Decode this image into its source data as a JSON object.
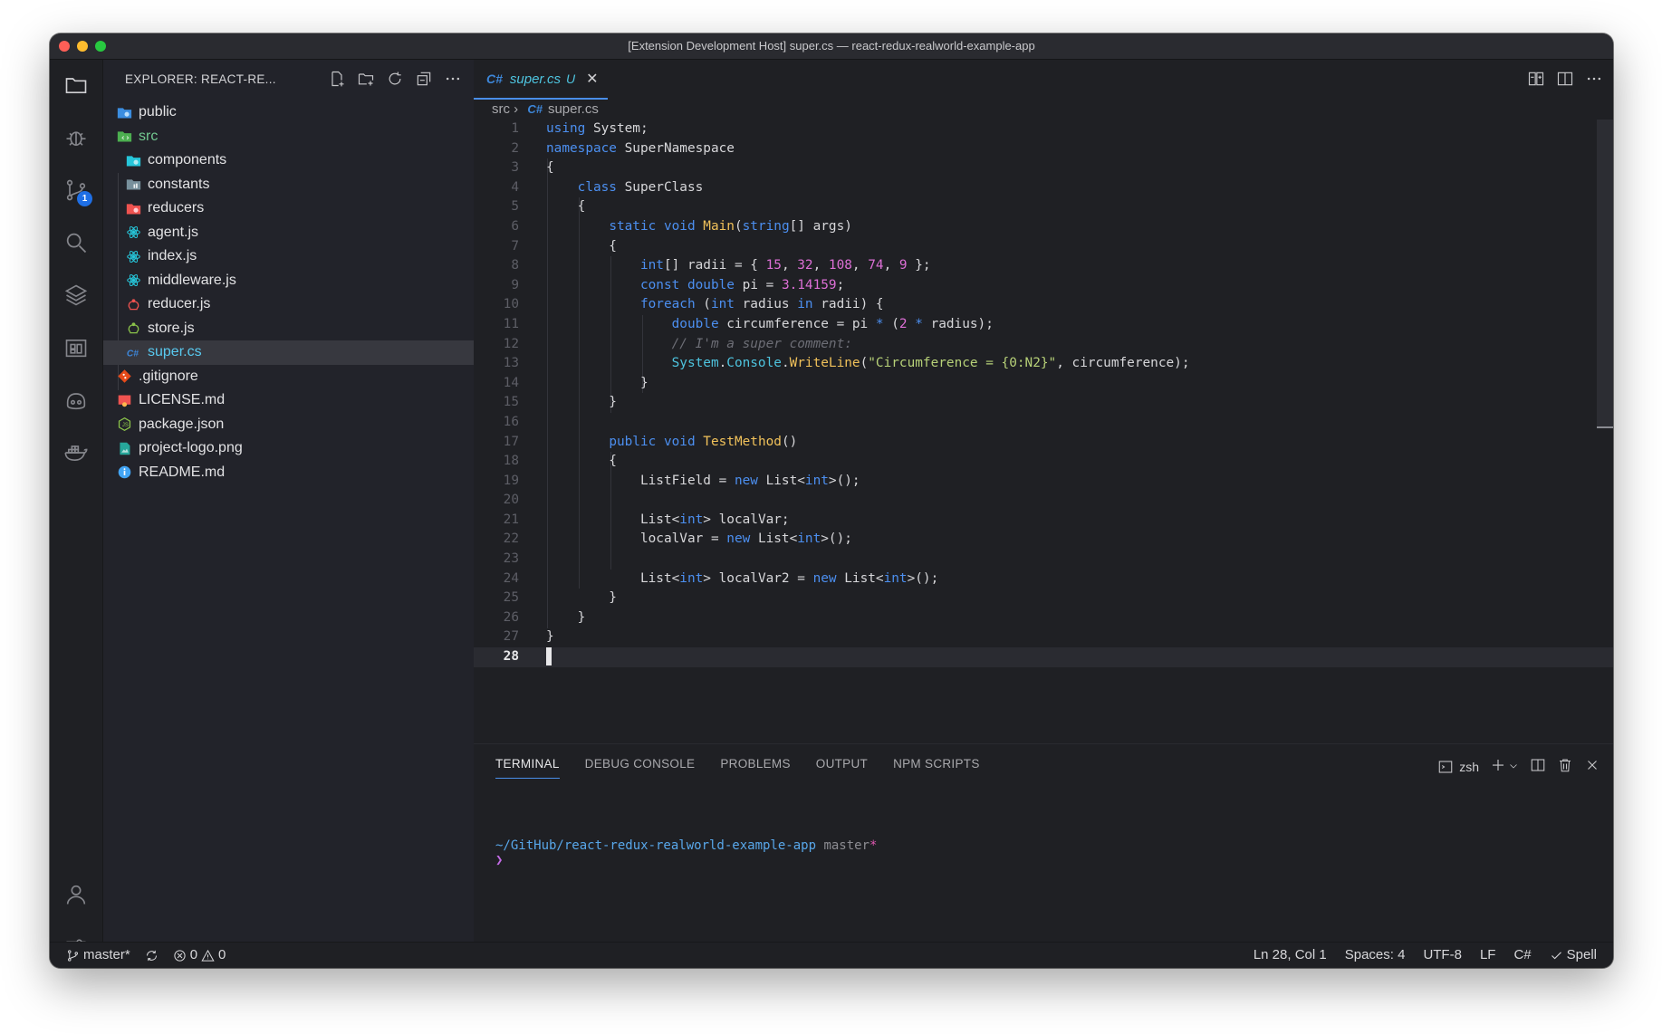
{
  "window": {
    "title": "[Extension Development Host] super.cs — react-redux-realworld-example-app"
  },
  "activity": {
    "scm_badge": "1"
  },
  "sidebar": {
    "title": "EXPLORER: REACT-RE...",
    "items": [
      {
        "label": "public",
        "icon": "folder-public-icon",
        "color": "#3b8de0"
      },
      {
        "label": "src",
        "icon": "folder-src-icon",
        "color": "#4caf50"
      },
      {
        "label": "components",
        "icon": "folder-components-icon",
        "color": "#26c6da"
      },
      {
        "label": "constants",
        "icon": "folder-constants-icon",
        "color": "#78909c"
      },
      {
        "label": "reducers",
        "icon": "folder-reducers-icon",
        "color": "#ef5350"
      },
      {
        "label": "agent.js",
        "icon": "react-icon",
        "color": "#26c6da"
      },
      {
        "label": "index.js",
        "icon": "react-icon",
        "color": "#26c6da"
      },
      {
        "label": "middleware.js",
        "icon": "react-icon",
        "color": "#26c6da"
      },
      {
        "label": "reducer.js",
        "icon": "redux-icon",
        "color": "#ef5350"
      },
      {
        "label": "store.js",
        "icon": "redux-store-icon",
        "color": "#8bc34a"
      },
      {
        "label": "super.cs",
        "icon": "csharp-icon",
        "color": "#3d86d8"
      },
      {
        "label": ".gitignore",
        "icon": "git-icon",
        "color": "#e64a19"
      },
      {
        "label": "LICENSE.md",
        "icon": "license-icon",
        "color": "#ef5350"
      },
      {
        "label": "package.json",
        "icon": "nodejs-icon",
        "color": "#8bc34a"
      },
      {
        "label": "project-logo.png",
        "icon": "image-icon",
        "color": "#26a69a"
      },
      {
        "label": "README.md",
        "icon": "info-icon",
        "color": "#42a5f5"
      }
    ]
  },
  "editor": {
    "tab": {
      "lang": "C#",
      "name": "super.cs",
      "status": "U",
      "close": "✕"
    },
    "breadcrumb": {
      "folder": "src",
      "lang": "C#",
      "file": "super.cs"
    },
    "active_line": "28"
  },
  "panel": {
    "tabs": [
      "TERMINAL",
      "DEBUG CONSOLE",
      "PROBLEMS",
      "OUTPUT",
      "NPM SCRIPTS"
    ],
    "shell": "zsh",
    "terminal": {
      "path": "~/GitHub/react-redux-realworld-example-app",
      "branch": "master",
      "dirty": "*",
      "prompt": "❯"
    }
  },
  "status": {
    "branch": "master*",
    "errors": "0",
    "warnings": "0",
    "position": "Ln 28, Col 1",
    "spaces": "Spaces: 4",
    "encoding": "UTF-8",
    "eol": "LF",
    "language": "C#",
    "spell": "Spell"
  }
}
